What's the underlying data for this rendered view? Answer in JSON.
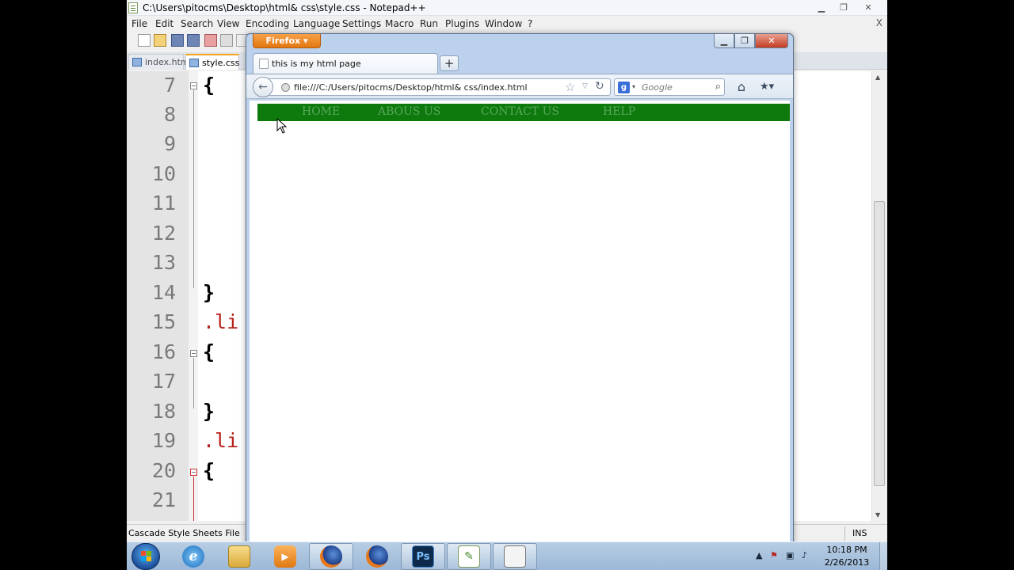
{
  "notepad": {
    "title": "C:\\Users\\pitocms\\Desktop\\html& css\\style.css - Notepad++",
    "menu": [
      "File",
      "Edit",
      "Search",
      "View",
      "Encoding",
      "Language",
      "Settings",
      "Macro",
      "Run",
      "Plugins",
      "Window",
      "?"
    ],
    "menu_close": "X",
    "tabs": [
      {
        "label": "index.html",
        "active": false
      },
      {
        "label": "style.css",
        "active": true
      }
    ],
    "lines": [
      {
        "num": "7",
        "code": "{"
      },
      {
        "num": "8",
        "code": ""
      },
      {
        "num": "9",
        "code": ""
      },
      {
        "num": "10",
        "code": ""
      },
      {
        "num": "11",
        "code": ""
      },
      {
        "num": "12",
        "code": ""
      },
      {
        "num": "13",
        "code": ""
      },
      {
        "num": "14",
        "code": "}"
      },
      {
        "num": "15",
        "code": ".li"
      },
      {
        "num": "16",
        "code": "{"
      },
      {
        "num": "17",
        "code": ""
      },
      {
        "num": "18",
        "code": "}"
      },
      {
        "num": "19",
        "code": ".li"
      },
      {
        "num": "20",
        "code": "{"
      },
      {
        "num": "21",
        "code": ""
      }
    ],
    "status": {
      "file_type": "Cascade Style Sheets File",
      "mode": "INS"
    }
  },
  "firefox": {
    "menu_button": "Firefox",
    "tab_title": "this is my html page",
    "new_tab": "+",
    "url": "file:///C:/Users/pitocms/Desktop/html& css/index.html",
    "search_placeholder": "Google",
    "page": {
      "nav_links": [
        "HOME",
        "ABOUS US",
        "CONTACT US",
        "HELP"
      ],
      "nav_bg": "#0e7a0e",
      "nav_text_color": "#5aa85a"
    }
  },
  "taskbar": {
    "apps": [
      {
        "name": "internet-explorer",
        "open": false
      },
      {
        "name": "file-explorer",
        "open": false
      },
      {
        "name": "media-player",
        "open": false
      },
      {
        "name": "firefox",
        "open": true
      },
      {
        "name": "firefox-alt",
        "open": false
      },
      {
        "name": "photoshop",
        "open": true,
        "label": "Ps"
      },
      {
        "name": "notepad-plus-plus",
        "open": true
      },
      {
        "name": "window-app",
        "open": true
      }
    ],
    "clock_time": "10:18 PM",
    "clock_date": "2/26/2013"
  }
}
